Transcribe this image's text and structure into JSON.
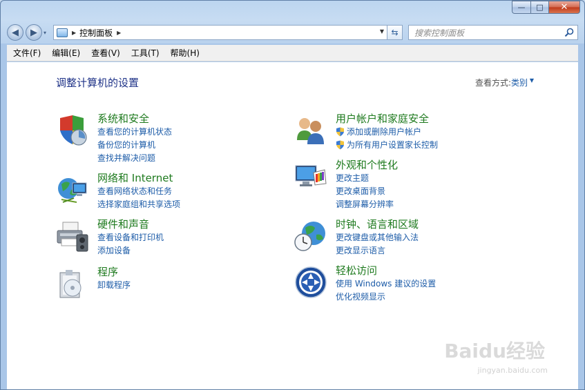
{
  "window": {
    "min_glyph": "—",
    "max_glyph": "□",
    "close_glyph": "✕"
  },
  "nav": {
    "back_glyph": "◀",
    "forward_glyph": "▶",
    "dropdown_glyph": "▾",
    "breadcrumb_sep": "▶",
    "breadcrumb": "控制面板",
    "breadcrumb_end": "▶",
    "address_dropdown": "▼",
    "refresh_glyph": "⇆",
    "search_placeholder": "搜索控制面板"
  },
  "menu": [
    "文件(F)",
    "编辑(E)",
    "查看(V)",
    "工具(T)",
    "帮助(H)"
  ],
  "content": {
    "title": "调整计算机的设置",
    "view_by_label": "查看方式:",
    "view_by_value": "类别",
    "view_by_arrow": "▼"
  },
  "categories": [
    {
      "id": "system-security",
      "icon": "shield-icon",
      "title": "系统和安全",
      "links": [
        "查看您的计算机状态",
        "备份您的计算机",
        "查找并解决问题"
      ]
    },
    {
      "id": "network-internet",
      "icon": "network-globe-icon",
      "title": "网络和 Internet",
      "links": [
        "查看网络状态和任务",
        "选择家庭组和共享选项"
      ]
    },
    {
      "id": "hardware-sound",
      "icon": "printer-icon",
      "title": "硬件和声音",
      "links": [
        "查看设备和打印机",
        "添加设备"
      ]
    },
    {
      "id": "programs",
      "icon": "programs-box-icon",
      "title": "程序",
      "links": [
        "卸载程序"
      ]
    },
    {
      "id": "user-accounts",
      "icon": "users-icon",
      "title": "用户帐户和家庭安全",
      "links": [
        "添加或删除用户帐户",
        "为所有用户设置家长控制"
      ]
    },
    {
      "id": "appearance",
      "icon": "monitor-palette-icon",
      "title": "外观和个性化",
      "links": [
        "更改主题",
        "更改桌面背景",
        "调整屏幕分辨率"
      ]
    },
    {
      "id": "clock-language",
      "icon": "clock-globe-icon",
      "title": "时钟、语言和区域",
      "links": [
        "更改键盘或其他输入法",
        "更改显示语言"
      ]
    },
    {
      "id": "ease-of-access",
      "icon": "ease-access-icon",
      "title": "轻松访问",
      "links": [
        "使用 Windows 建议的设置",
        "优化视频显示"
      ]
    }
  ],
  "watermark": {
    "text": "Baidu经验",
    "url": "jingyan.baidu.com"
  },
  "colors": {
    "category_title": "#1e7a1e",
    "link": "#1d5ca8",
    "page_title": "#1e3287"
  }
}
